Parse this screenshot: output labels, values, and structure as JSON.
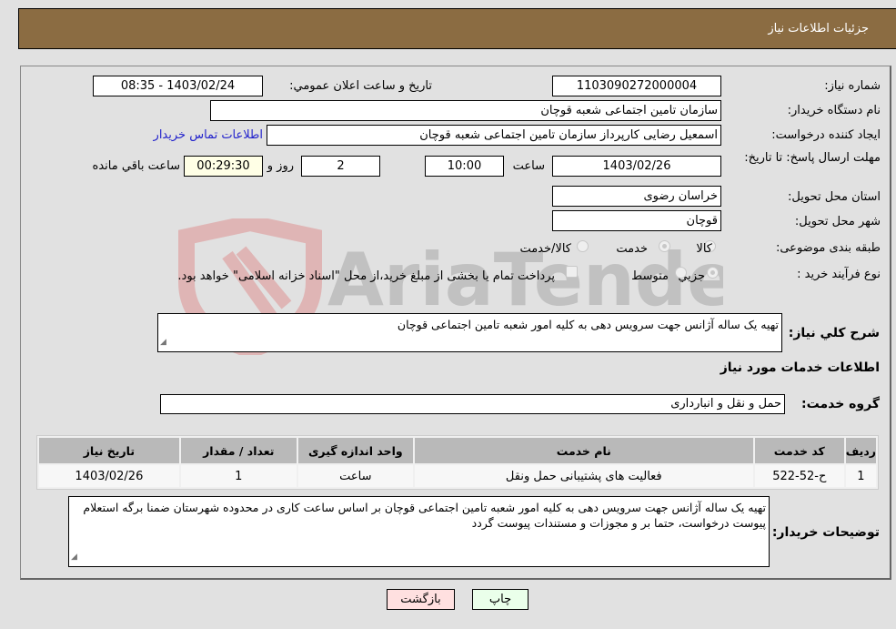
{
  "header": {
    "title": "جزئیات اطلاعات نیاز"
  },
  "form": {
    "need_number": {
      "label": "شماره نیاز:",
      "value": "1103090272000004"
    },
    "announce_datetime": {
      "label": "تاريخ و ساعت اعلان عمومي:",
      "value": "1403/02/24 - 08:35"
    },
    "buyer_org": {
      "label": "نام دستگاه خریدار:",
      "value": "سازمان تامین اجتماعی شعبه قوچان"
    },
    "requester": {
      "label": "ایجاد کننده درخواست:",
      "value": "اسمعیل رضایی کارپرداز سازمان تامین اجتماعی شعبه قوچان"
    },
    "contact_link": "اطلاعات تماس خریدار",
    "deadline": {
      "label": "مهلت ارسال پاسخ: تا تاریخ:",
      "date": "1403/02/26",
      "time_label": "ساعت",
      "time": "10:00",
      "days": "2",
      "days_label": "روز و",
      "remaining": "00:29:30",
      "remaining_label": "ساعت باقي مانده"
    },
    "province": {
      "label": "استان محل تحویل:",
      "value": "خراسان رضوی"
    },
    "city": {
      "label": "شهر محل تحویل:",
      "value": "قوچان"
    },
    "category": {
      "label": "طبقه بندی موضوعی:",
      "options": [
        "کالا",
        "خدمت",
        "کالا/خدمت"
      ],
      "selected": "خدمت"
    },
    "purchase_type": {
      "label": "نوع فرآیند خرید :",
      "options": [
        "جزيي",
        "متوسط"
      ],
      "selected": "جزيي",
      "treasury_note": "پرداخت تمام یا بخشی از مبلغ خرید،از محل \"اسناد خزانه اسلامی\" خواهد بود."
    },
    "general_desc": {
      "label": "شرح کلي نياز:",
      "value": "تهیه یک ساله آژانس جهت سرویس دهی به کلیه امور شعبه تامین اجتماعی قوچان"
    }
  },
  "services": {
    "section_title": "اطلاعات خدمات مورد نياز",
    "group": {
      "label": "گروه خدمت:",
      "value": "حمل و نقل و انبارداری"
    },
    "table": {
      "headers": [
        "رديف",
        "کد خدمت",
        "نام خدمت",
        "واحد اندازه گيری",
        "تعداد / مقدار",
        "تاريخ نياز"
      ],
      "rows": [
        [
          "1",
          "ح-52-522",
          "فعالیت های پشتیبانی حمل ونقل",
          "ساعت",
          "1",
          "1403/02/26"
        ]
      ]
    }
  },
  "buyer_notes": {
    "label": "توضيحات خريدار:",
    "value": "تهیه یک ساله آژانس جهت سرویس دهی به کلیه امور شعبه تامین اجتماعی قوچان بر اساس ساعت کاری در محدوده شهرستان ضمنا برگه استعلام پیوست درخواست، حتما بر و مجوزات و مستندات پیوست گردد"
  },
  "buttons": {
    "print": "چاپ",
    "back": "بازگشت"
  },
  "colors": {
    "header_bg": "#8b6c42",
    "print_bg": "#eaffea",
    "back_bg": "#ffe0e0",
    "remaining_bg": "#ffffe6",
    "link": "#2222cc"
  }
}
